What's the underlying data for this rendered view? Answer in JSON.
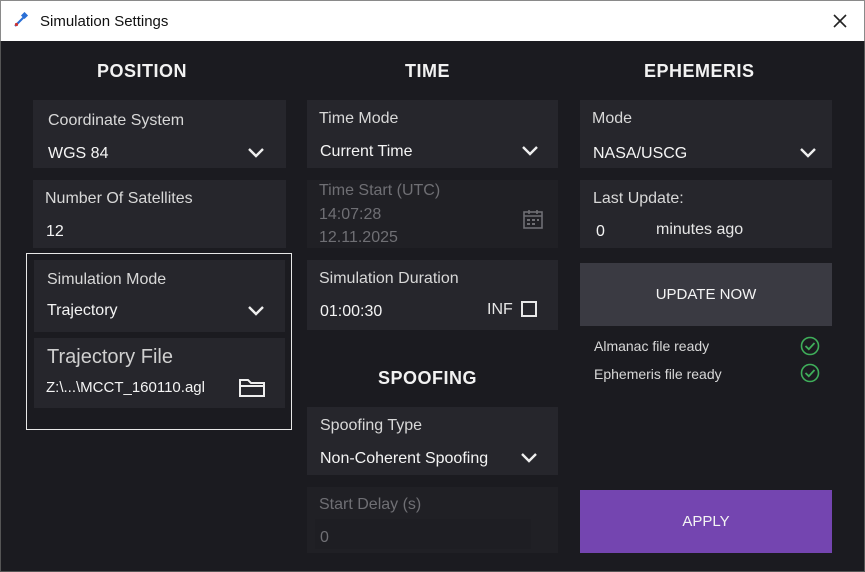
{
  "window": {
    "title": "Simulation Settings",
    "app_icon": "satellite-icon",
    "close_icon": "close-icon"
  },
  "position": {
    "heading": "POSITION",
    "coordinate_system": {
      "label": "Coordinate System",
      "value": "WGS 84"
    },
    "number_of_satellites": {
      "label": "Number Of Satellites",
      "value": "12"
    },
    "simulation_mode": {
      "label": "Simulation Mode",
      "value": "Trajectory"
    },
    "trajectory_file": {
      "label": "Trajectory File",
      "value": "Z:\\...\\MCCT_160110.agl",
      "icon": "folder-icon"
    }
  },
  "time": {
    "heading": "TIME",
    "time_mode": {
      "label": "Time Mode",
      "value": "Current Time"
    },
    "time_start": {
      "label": "Time Start (UTC)",
      "time": "14:07:28",
      "date": "12.11.2025",
      "icon": "calendar-icon"
    },
    "simulation_duration": {
      "label": "Simulation Duration",
      "value": "01:00:30",
      "inf_label": "INF",
      "inf_checked": false
    }
  },
  "spoofing": {
    "heading": "SPOOFING",
    "spoofing_type": {
      "label": "Spoofing Type",
      "value": "Non-Coherent Spoofing"
    },
    "start_delay": {
      "label": "Start Delay (s)",
      "value": "0"
    }
  },
  "ephemeris": {
    "heading": "EPHEMERIS",
    "mode": {
      "label": "Mode",
      "value": "NASA/USCG"
    },
    "last_update": {
      "label": "Last Update:",
      "value": "0",
      "suffix": "minutes ago"
    },
    "update_button": "UPDATE NOW",
    "status": [
      {
        "text": "Almanac file ready",
        "icon": "check-circle-icon"
      },
      {
        "text": "Ephemeris file ready",
        "icon": "check-circle-icon"
      }
    ],
    "apply_button": "APPLY"
  },
  "colors": {
    "background": "#1b1b20",
    "panel": "#26262c",
    "apply": "#7445b0",
    "check": "#3fae5a"
  }
}
